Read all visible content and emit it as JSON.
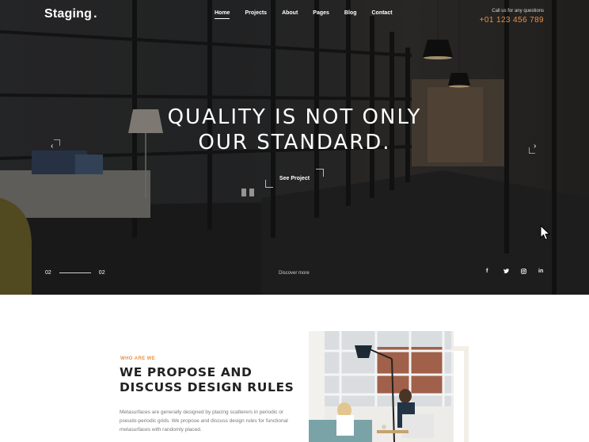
{
  "header": {
    "logo": "Staging",
    "logo_dot": ".",
    "nav": [
      "Home",
      "Projects",
      "About",
      "Pages",
      "Blog",
      "Contact"
    ],
    "active_nav": "Home",
    "contact_label": "Call us for any questions",
    "contact_phone": "+01 123 456 789"
  },
  "hero": {
    "headline_line1": "QUALITY IS NOT ONLY",
    "headline_line2": "OUR STANDARD.",
    "cta": "See Project",
    "prev_icon": "chevron-left-icon",
    "next_icon": "chevron-right-icon",
    "slide_current": "02",
    "slide_total": "02",
    "discover": "Discover more",
    "socials": [
      {
        "icon": "facebook-icon",
        "glyph": "f"
      },
      {
        "icon": "twitter-icon",
        "glyph": "t"
      },
      {
        "icon": "instagram-icon",
        "glyph": "◎"
      },
      {
        "icon": "linkedin-icon",
        "glyph": "in"
      }
    ]
  },
  "about": {
    "eyebrow": "WHO ARE WE",
    "title_line1": "WE PROPOSE AND",
    "title_line2": "DISCUSS DESIGN RULES",
    "text": "Metasurfaces are generally designed by placing scatterers in periodic or pseudo-periodic grids. We propose and discuss design rules for functional metasurfaces with randomly placed."
  },
  "colors": {
    "accent": "#e69346",
    "dark": "#222222",
    "hero_text": "#ffffff"
  }
}
